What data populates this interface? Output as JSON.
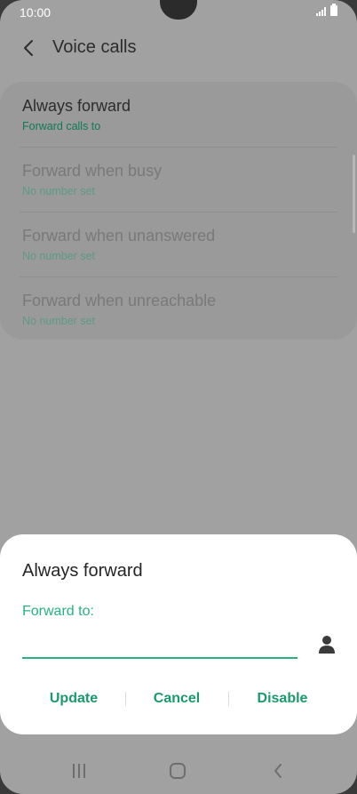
{
  "status_bar": {
    "time": "10:00"
  },
  "header": {
    "title": "Voice calls"
  },
  "forward_options": [
    {
      "title": "Always forward",
      "subtitle": "Forward calls to"
    },
    {
      "title": "Forward when busy",
      "subtitle": "No number set"
    },
    {
      "title": "Forward when unanswered",
      "subtitle": "No number set"
    },
    {
      "title": "Forward when unreachable",
      "subtitle": "No number set"
    }
  ],
  "dialog": {
    "title": "Always forward",
    "field_label": "Forward to:",
    "field_value": "",
    "buttons": {
      "update": "Update",
      "cancel": "Cancel",
      "disable": "Disable"
    }
  },
  "colors": {
    "accent": "#27b37f",
    "accent_dark": "#1a9a6b",
    "scrim": "#a1a1a1"
  },
  "icons": {
    "back": "chevron-left-icon",
    "contact": "person-icon",
    "signal": "signal-icon",
    "battery": "battery-icon",
    "nav_recents": "recents-icon",
    "nav_home": "home-icon",
    "nav_back": "back-chevron-icon"
  }
}
